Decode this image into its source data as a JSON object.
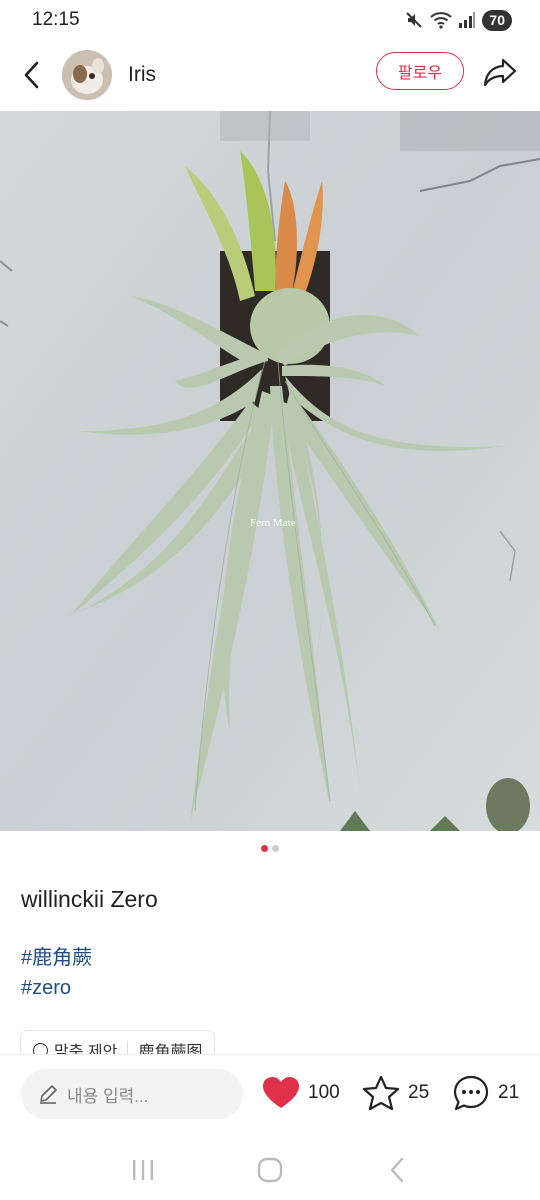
{
  "status_bar": {
    "time": "12:15",
    "battery": "70",
    "icons": [
      "mute-icon",
      "wifi-icon",
      "signal-icon"
    ]
  },
  "header": {
    "username": "Iris",
    "follow_label": "팔로우"
  },
  "post": {
    "watermark": "Fern Mate",
    "page_count": 2,
    "active_page": 1,
    "title": "willinckii Zero",
    "tags": [
      "#鹿角蕨",
      "#zero"
    ],
    "chips": [
      "맞춤 제안",
      "鹿角蕨图"
    ]
  },
  "bottom_bar": {
    "comment_placeholder": "내용 입력...",
    "likes": "100",
    "favorites": "25",
    "comments": "21"
  },
  "colors": {
    "accent": "#e0304a",
    "tag": "#1f4d84"
  }
}
